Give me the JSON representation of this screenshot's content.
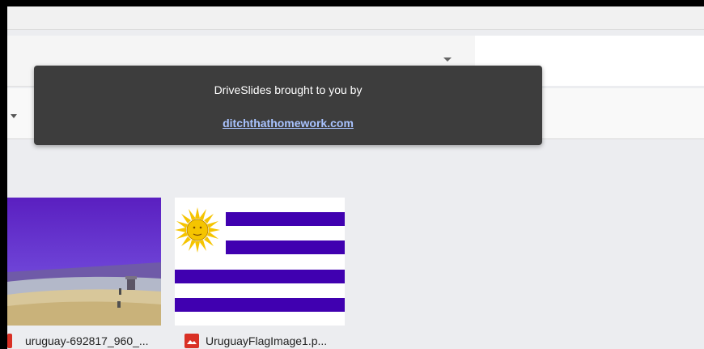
{
  "tooltip": {
    "text": "DriveSlides brought to you by",
    "link": "ditchthathomework.com"
  },
  "files": [
    {
      "name": "uruguay-692817_960_...",
      "icon": "image-file-icon"
    },
    {
      "name": "UruguayFlagImage1.p...",
      "icon": "image-file-icon"
    }
  ],
  "colors": {
    "tooltip_bg": "#3d3d3d",
    "link": "#a9c3ff",
    "file_icon": "#d93025",
    "flag_stripe": "#4000b0",
    "sun": "#f5c400"
  }
}
